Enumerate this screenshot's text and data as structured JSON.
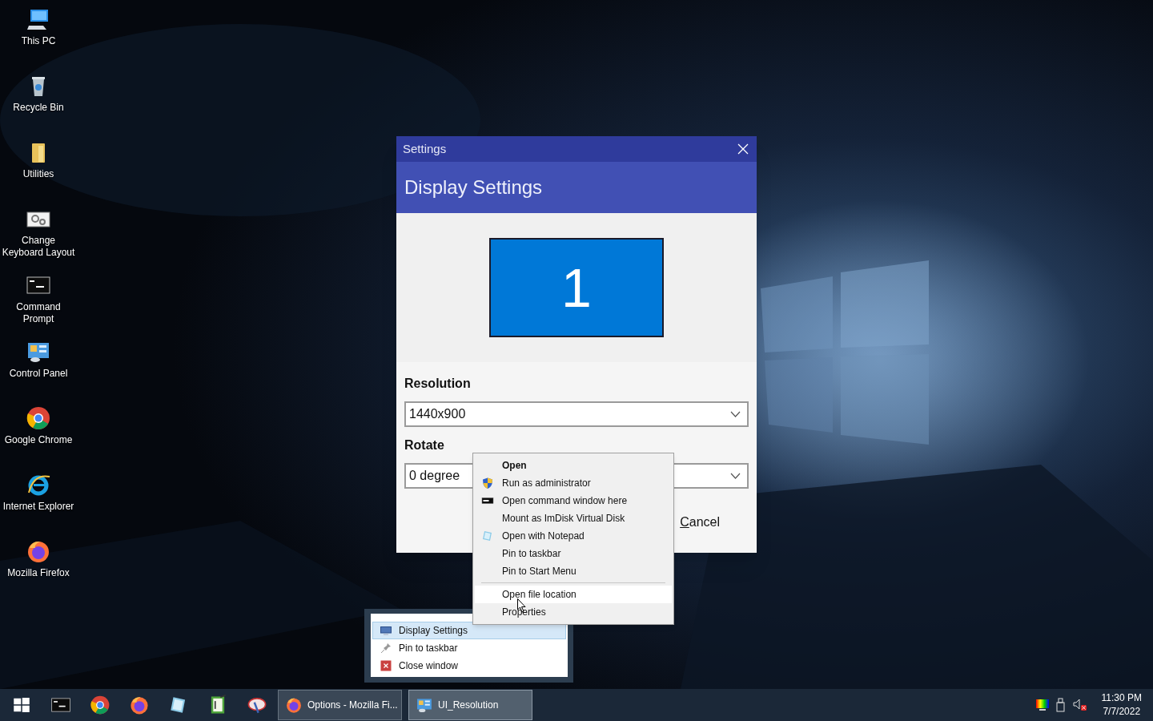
{
  "desktop_icons": [
    {
      "label": "This PC",
      "kind": "pc"
    },
    {
      "label": "Recycle Bin",
      "kind": "bin"
    },
    {
      "label": "Utilities",
      "kind": "folder"
    },
    {
      "label": "Change Keyboard Layout",
      "kind": "keyboard"
    },
    {
      "label": "Command Prompt",
      "kind": "cmd"
    },
    {
      "label": "Control Panel",
      "kind": "panel"
    },
    {
      "label": "Google Chrome",
      "kind": "chrome"
    },
    {
      "label": "Internet Explorer",
      "kind": "ie"
    },
    {
      "label": "Mozilla Firefox",
      "kind": "firefox"
    }
  ],
  "dialog": {
    "title": "Settings",
    "header": "Display Settings",
    "monitor_label": "1",
    "resolution": {
      "label": "Resolution",
      "value": "1440x900"
    },
    "rotate": {
      "label": "Rotate",
      "value": "0 degree"
    },
    "cancel": "Cancel"
  },
  "context_menu": {
    "items": [
      {
        "label": "Open",
        "kind": "default",
        "selected": false
      },
      {
        "label": "Run as administrator",
        "kind": "shield",
        "selected": false
      },
      {
        "label": "Open command window here",
        "kind": "console",
        "selected": false
      },
      {
        "label": "Mount as ImDisk Virtual Disk",
        "kind": "plain",
        "selected": false
      },
      {
        "label": "Open with Notepad",
        "kind": "notepad",
        "selected": false
      },
      {
        "label": "Pin to taskbar",
        "kind": "plain",
        "selected": false
      },
      {
        "label": "Pin to Start Menu",
        "kind": "plain",
        "selected": false
      },
      {
        "kind": "separator"
      },
      {
        "label": "Open file location",
        "kind": "plain",
        "selected": true
      },
      {
        "label": "Properties",
        "kind": "plain",
        "selected": false
      }
    ]
  },
  "jump_list": {
    "items": [
      {
        "label": "Display Settings",
        "kind": "monitor",
        "selected": true
      },
      {
        "label": "Pin to taskbar",
        "kind": "pin",
        "selected": false
      },
      {
        "label": "Close window",
        "kind": "close",
        "selected": false
      }
    ]
  },
  "taskbar": {
    "pinned": [
      {
        "kind": "start"
      },
      {
        "kind": "cmd"
      },
      {
        "kind": "chrome"
      },
      {
        "kind": "firefox"
      },
      {
        "kind": "notepad"
      },
      {
        "kind": "editor"
      },
      {
        "kind": "paint"
      }
    ],
    "windows": [
      {
        "label": "Options - Mozilla Fi...",
        "kind": "firefox",
        "selected": false
      },
      {
        "label": "UI_Resolution",
        "kind": "panel",
        "selected": true
      }
    ],
    "tray": {
      "time": "11:30 PM",
      "date": "7/7/2022"
    }
  }
}
